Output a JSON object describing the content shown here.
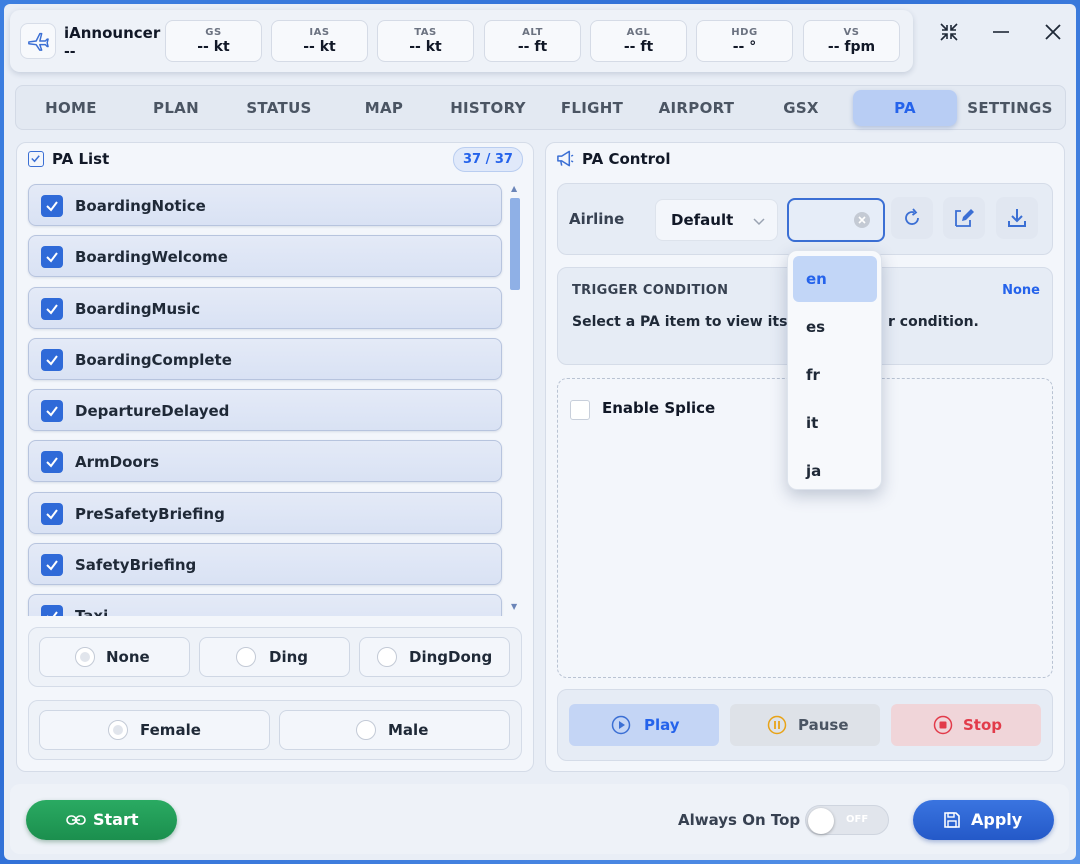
{
  "app": {
    "title": "iAnnouncer",
    "subtitle": "--"
  },
  "stats": [
    {
      "label": "GS",
      "value": "-- kt"
    },
    {
      "label": "IAS",
      "value": "-- kt"
    },
    {
      "label": "TAS",
      "value": "-- kt"
    },
    {
      "label": "ALT",
      "value": "-- ft"
    },
    {
      "label": "AGL",
      "value": "-- ft"
    },
    {
      "label": "HDG",
      "value": "-- °"
    },
    {
      "label": "VS",
      "value": "-- fpm"
    }
  ],
  "tabs": [
    "HOME",
    "PLAN",
    "STATUS",
    "MAP",
    "HISTORY",
    "FLIGHT",
    "AIRPORT",
    "GSX",
    "PA",
    "SETTINGS"
  ],
  "active_tab": "PA",
  "pa_list": {
    "title": "PA List",
    "count": "37 / 37",
    "items": [
      "BoardingNotice",
      "BoardingWelcome",
      "BoardingMusic",
      "BoardingComplete",
      "DepartureDelayed",
      "ArmDoors",
      "PreSafetyBriefing",
      "SafetyBriefing",
      "Taxi"
    ]
  },
  "chime_options": [
    "None",
    "Ding",
    "DingDong"
  ],
  "voice_options": [
    "Female",
    "Male"
  ],
  "pa_control": {
    "title": "PA Control",
    "airline_label": "Airline",
    "airline_value": "Default",
    "language_value": "",
    "trigger": {
      "title": "TRIGGER CONDITION",
      "status": "None",
      "text_left": "Select a PA item to view its aut",
      "text_right": "r condition."
    },
    "enable_splice": "Enable Splice",
    "play": "Play",
    "pause": "Pause",
    "stop": "Stop"
  },
  "language_options": [
    "en",
    "es",
    "fr",
    "it",
    "ja"
  ],
  "footer": {
    "start": "Start",
    "always_on_top": "Always On Top",
    "toggle_state": "OFF",
    "apply": "Apply"
  },
  "colors": {
    "accent": "#2f6ad8",
    "start_green": "#1f9a55",
    "stop_red": "#e23b4a",
    "pause_amber": "#e8a317"
  }
}
